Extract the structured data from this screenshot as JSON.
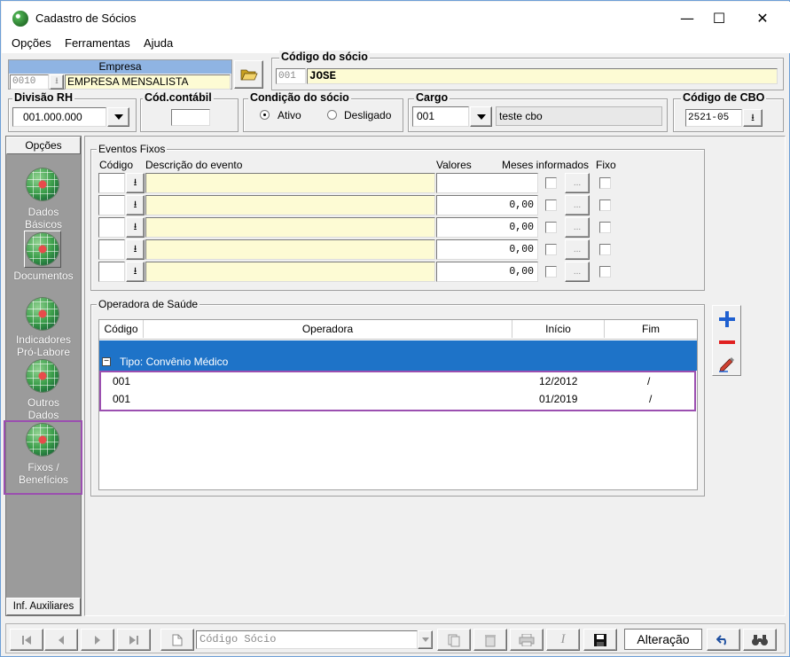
{
  "window": {
    "title": "Cadastro de Sócios",
    "minimize": "—",
    "maximize": "☐",
    "close": "✕"
  },
  "menu": [
    "Opções",
    "Ferramentas",
    "Ajuda"
  ],
  "empresa": {
    "label": "Empresa",
    "code": "0010",
    "name": "EMPRESA MENSALISTA"
  },
  "socio": {
    "label": "Código do sócio",
    "code": "001",
    "name": "JOSE"
  },
  "divisao": {
    "label": "Divisão RH",
    "value": "001.000.000"
  },
  "cod_contabil": {
    "label": "Cód.contábil",
    "value": ""
  },
  "condicao": {
    "label": "Condição do sócio",
    "ativo": "Ativo",
    "desligado": "Desligado"
  },
  "cargo": {
    "label": "Cargo",
    "code": "001",
    "description": "teste cbo"
  },
  "cbo": {
    "label": "Código de CBO",
    "value": "2521-05"
  },
  "sidebar": {
    "header": "Opções",
    "footer": "Inf. Auxiliares",
    "items": [
      {
        "line1": "Dados",
        "line2": "Básicos"
      },
      {
        "line1": "Documentos",
        "line2": ""
      },
      {
        "line1": "Indicadores",
        "line2": "Pró-Labore"
      },
      {
        "line1": "Outros",
        "line2": "Dados"
      },
      {
        "line1": "Fixos /",
        "line2": "Benefícios"
      }
    ]
  },
  "eventos": {
    "title": "Eventos Fixos",
    "col_codigo": "Código",
    "col_descricao": "Descrição do evento",
    "col_valores": "Valores",
    "col_meses": "Meses informados",
    "col_fixo": "Fixo",
    "ellipsis": "...",
    "rows": [
      {
        "value": ""
      },
      {
        "value": "0,00"
      },
      {
        "value": "0,00"
      },
      {
        "value": "0,00"
      },
      {
        "value": "0,00"
      }
    ]
  },
  "operadora": {
    "title": "Operadora de Saúde",
    "col_codigo": "Código",
    "col_operadora": "Operadora",
    "col_inicio": "Início",
    "col_fim": "Fim",
    "group": "Tipo: Convênio Médico",
    "rows": [
      {
        "codigo": "001",
        "inicio": "12/2012",
        "fim": "/"
      },
      {
        "codigo": "001",
        "inicio": "01/2019",
        "fim": "/"
      }
    ]
  },
  "navbar": {
    "search_placeholder": "Código Sócio",
    "status": "Alteração"
  },
  "colors": {
    "accent_blue": "#1e73c8",
    "highlight_purple": "#9b4fb0",
    "field_yellow": "#fdfbd4"
  }
}
